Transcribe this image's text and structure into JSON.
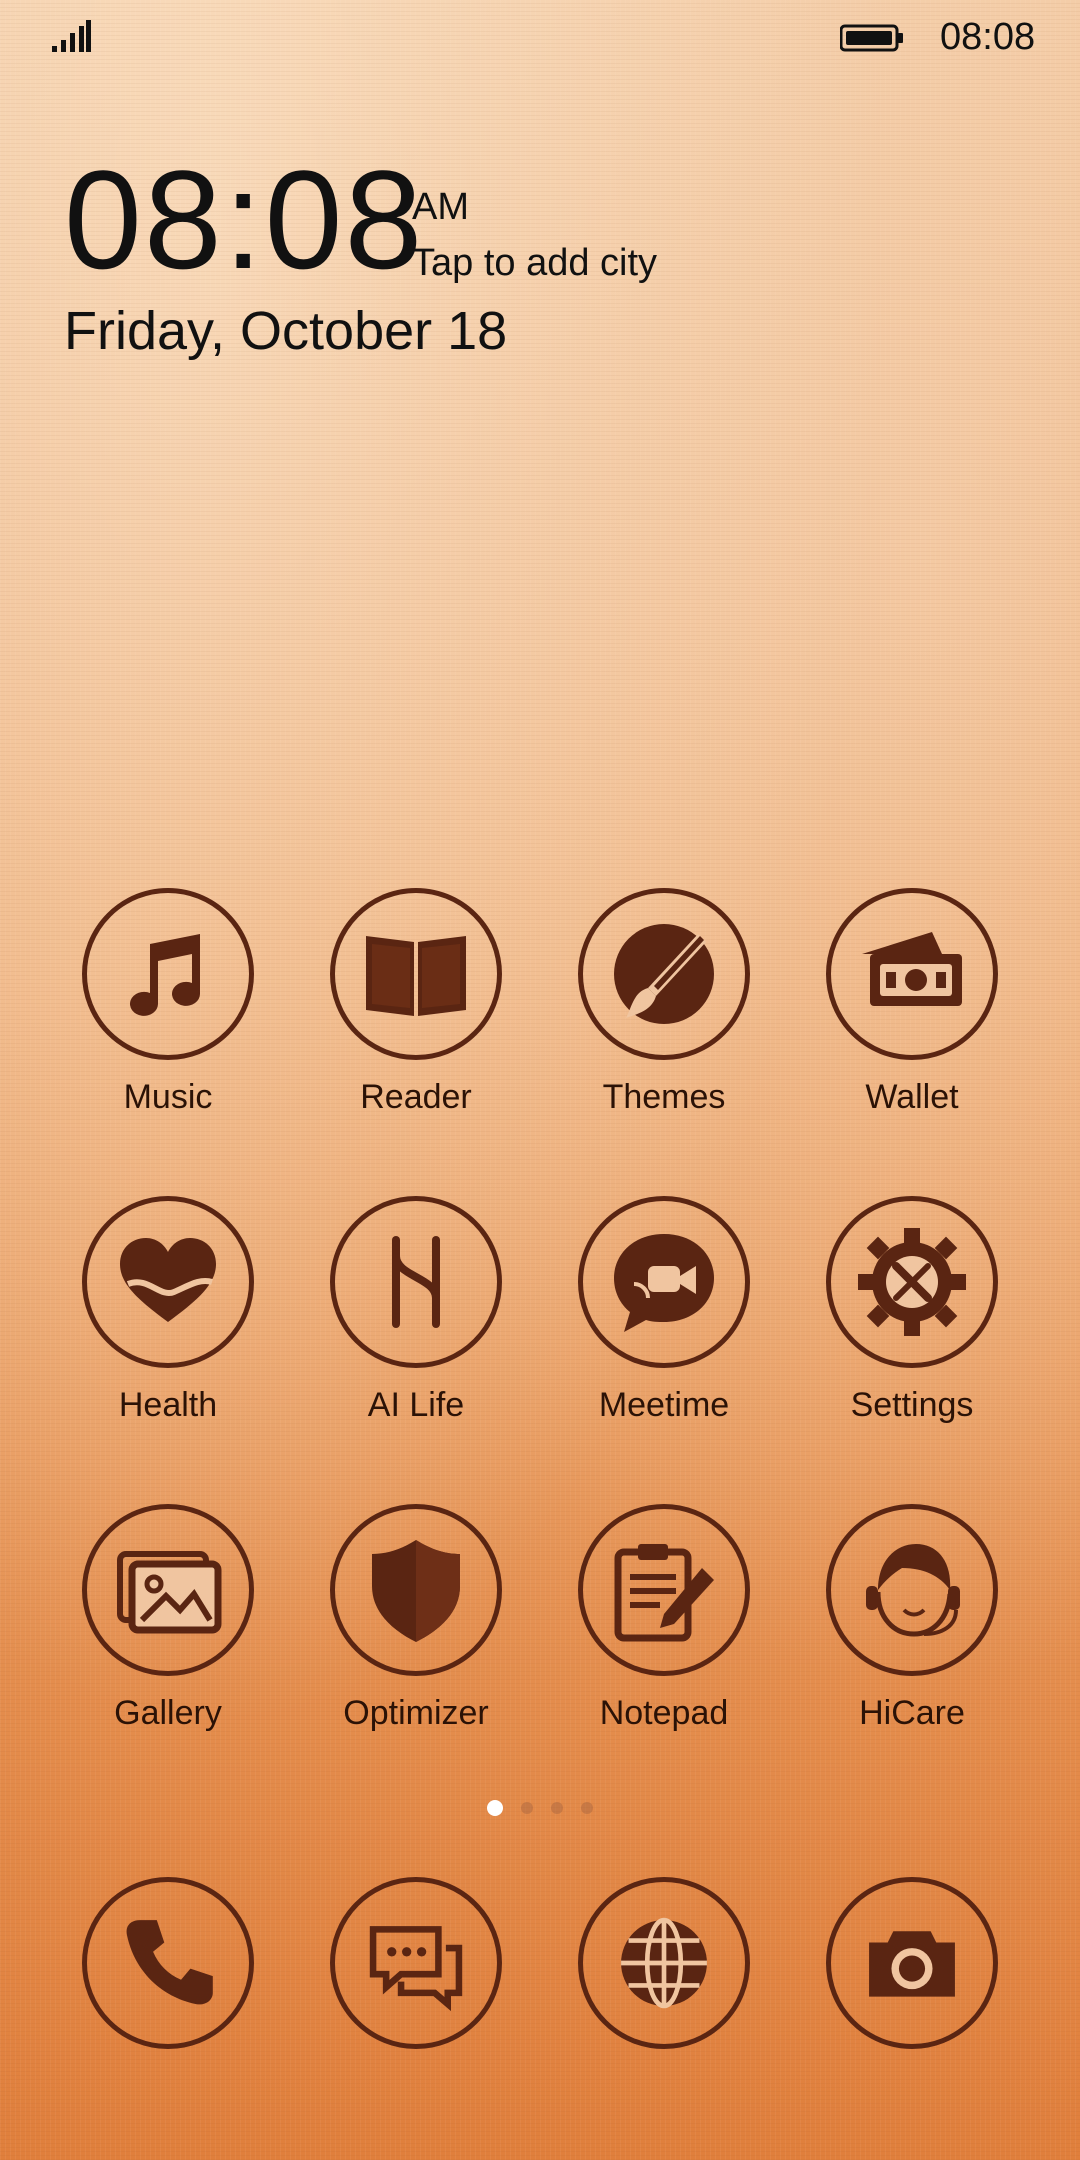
{
  "status_bar": {
    "time": "08:08",
    "signal_icon": "signal-bars",
    "battery_icon": "battery-full"
  },
  "clock_widget": {
    "time": "08:08",
    "ampm": "AM",
    "city_prompt": "Tap to add city",
    "date": "Friday, October 18"
  },
  "apps": [
    {
      "label": "Music",
      "icon": "music-note-icon"
    },
    {
      "label": "Reader",
      "icon": "book-icon"
    },
    {
      "label": "Themes",
      "icon": "paintbrush-icon"
    },
    {
      "label": "Wallet",
      "icon": "wallet-icon"
    },
    {
      "label": "Health",
      "icon": "heart-icon"
    },
    {
      "label": "AI Life",
      "icon": "ai-life-icon"
    },
    {
      "label": "Meetime",
      "icon": "video-chat-icon"
    },
    {
      "label": "Settings",
      "icon": "gear-tools-icon"
    },
    {
      "label": "Gallery",
      "icon": "gallery-icon"
    },
    {
      "label": "Optimizer",
      "icon": "shield-icon"
    },
    {
      "label": "Notepad",
      "icon": "notepad-pencil-icon"
    },
    {
      "label": "HiCare",
      "icon": "headset-person-icon"
    }
  ],
  "page_indicator": {
    "pages": 4,
    "active": 1
  },
  "dock": [
    {
      "icon": "phone-icon"
    },
    {
      "icon": "messages-icon"
    },
    {
      "icon": "browser-globe-icon"
    },
    {
      "icon": "camera-icon"
    }
  ],
  "colors": {
    "icon_stroke": "#5a2512",
    "icon_fill": "#5a2512",
    "text": "#111111"
  }
}
